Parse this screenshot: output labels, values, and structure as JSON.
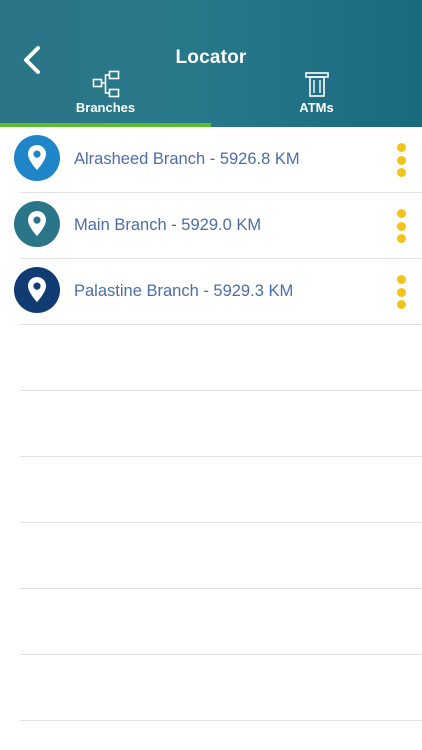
{
  "header": {
    "title": "Locator",
    "back_icon": "chevron-left-icon"
  },
  "tabs": [
    {
      "label": "Branches",
      "icon": "branches-network-icon",
      "selected": true
    },
    {
      "label": "ATMs",
      "icon": "atm-machine-icon",
      "selected": false
    }
  ],
  "colors": {
    "header": "#27798a",
    "tab_indicator": "#5dbb2e",
    "text": "#4b6ea8",
    "menu_dots": "#f2c318",
    "pin_1": "#1f85c9",
    "pin_2": "#2a7688",
    "pin_3": "#113b73"
  },
  "branches": [
    {
      "label": "Alrasheed Branch - 5926.8 KM",
      "pin_color": "#1f85c9"
    },
    {
      "label": "Main Branch - 5929.0 KM",
      "pin_color": "#2a7688"
    },
    {
      "label": "Palastine Branch - 5929.3 KM",
      "pin_color": "#113b73"
    }
  ]
}
